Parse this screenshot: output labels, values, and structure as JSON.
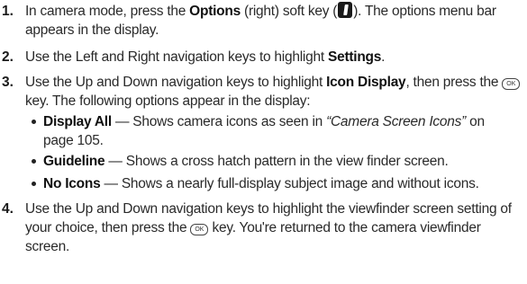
{
  "steps": [
    {
      "number": "1.",
      "parts": {
        "a": "In camera mode, press the ",
        "b": "Options",
        "c": " (right) soft key (",
        "d": "). The options menu bar appears in the display."
      },
      "icon": "right-soft-key-icon"
    },
    {
      "number": "2.",
      "parts": {
        "a": "Use the Left and Right navigation keys to highlight ",
        "b": "Settings",
        "c": "."
      }
    },
    {
      "number": "3.",
      "parts": {
        "a": "Use the Up and Down navigation keys to highlight ",
        "b": "Icon Display",
        "c": ", then press the ",
        "d": " key. The following options appear in the display:"
      },
      "icon": "ok-key-icon",
      "ok_label": "OK"
    },
    {
      "number": "4.",
      "parts": {
        "a": "Use the Up and Down navigation keys to highlight the viewfinder screen setting of your choice, then press the ",
        "b": " key. You're returned to the camera viewfinder screen."
      },
      "icon": "ok-key-icon",
      "ok_label": "OK"
    }
  ],
  "options": [
    {
      "name": "Display All",
      "desc_a": " — Shows camera icons as seen in ",
      "ref": "“Camera Screen Icons”",
      "desc_b": " on page 105."
    },
    {
      "name": "Guideline",
      "desc_a": " — Shows a cross hatch pattern in the view finder screen."
    },
    {
      "name": "No Icons",
      "desc_a": " — Shows a nearly full-display subject image and without icons."
    }
  ]
}
